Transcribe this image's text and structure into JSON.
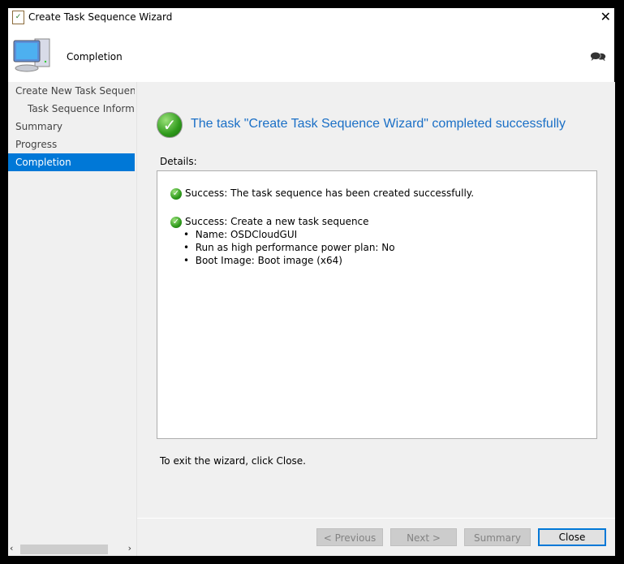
{
  "window": {
    "title": "Create Task Sequence Wizard"
  },
  "header": {
    "title": "Completion"
  },
  "nav": {
    "items": [
      {
        "label": "Create New Task Sequence"
      },
      {
        "label": "Task Sequence Information"
      },
      {
        "label": "Summary"
      },
      {
        "label": "Progress"
      },
      {
        "label": "Completion"
      }
    ]
  },
  "main": {
    "headline": "The task \"Create Task Sequence Wizard\" completed successfully",
    "details_label": "Details:",
    "details": {
      "line1": "Success: The task sequence has been created successfully.",
      "line2": "Success: Create a new task sequence",
      "bullets": [
        "Name: OSDCloudGUI",
        "Run as high performance power plan: No",
        "Boot Image: Boot image (x64)"
      ]
    },
    "exit_text": "To exit the wizard, click Close."
  },
  "buttons": {
    "previous": "< Previous",
    "next": "Next >",
    "summary": "Summary",
    "close": "Close"
  },
  "colors": {
    "accent": "#0078d7",
    "headline": "#1a6fc6",
    "success": "#2f9a1c"
  }
}
